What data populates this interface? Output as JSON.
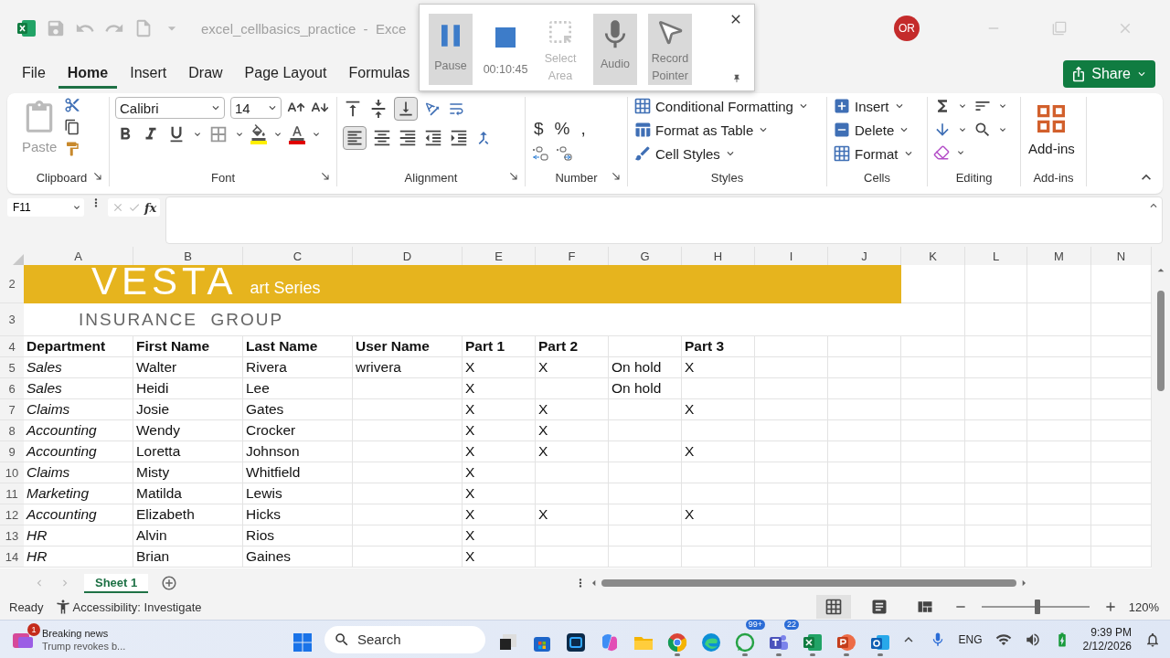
{
  "title_bar": {
    "document": "excel_cellbasics_practice  -  Exce",
    "avatar": "OR"
  },
  "ribbon_tabs": [
    {
      "label": "File",
      "selected": false
    },
    {
      "label": "Home",
      "selected": true
    },
    {
      "label": "Insert",
      "selected": false
    },
    {
      "label": "Draw",
      "selected": false
    },
    {
      "label": "Page Layout",
      "selected": false
    },
    {
      "label": "Formulas",
      "selected": false
    }
  ],
  "share": "Share",
  "ribbon": {
    "clipboard": {
      "paste": "Paste",
      "label": "Clipboard"
    },
    "font": {
      "name": "Calibri",
      "size": "14",
      "label": "Font"
    },
    "alignment": {
      "label": "Alignment"
    },
    "number": {
      "currency": "$",
      "percent": "%",
      "comma": ",",
      "label": "Number"
    },
    "styles": {
      "items": [
        "Conditional Formatting",
        "Format as Table",
        "Cell Styles"
      ],
      "label": "Styles"
    },
    "cells": {
      "items": [
        "Insert",
        "Delete",
        "Format"
      ],
      "label": "Cells"
    },
    "editing": {
      "label": "Editing"
    },
    "addins": {
      "button": "Add-ins",
      "label": "Add-ins"
    }
  },
  "recorder": {
    "items": [
      {
        "kind": "pause",
        "label": "Pause",
        "on": true,
        "disabled": false
      },
      {
        "kind": "timer",
        "label": "00:10:45",
        "on": false,
        "disabled": false
      },
      {
        "kind": "select",
        "label": "Select Area",
        "on": false,
        "disabled": true
      },
      {
        "kind": "audio",
        "label": "Audio",
        "on": true,
        "disabled": false
      },
      {
        "kind": "pointer",
        "label": "Record Pointer",
        "on": true,
        "disabled": false
      }
    ]
  },
  "formula_bar": {
    "name_box": "F11",
    "fx": "fx"
  },
  "sheet": {
    "columns": [
      "A",
      "B",
      "C",
      "D",
      "E",
      "F",
      "G",
      "H",
      "I",
      "J",
      "K",
      "L",
      "M",
      "N"
    ],
    "banner": {
      "row": "2",
      "logo": "VESTA",
      "subtitle": "art Series"
    },
    "logo_row": {
      "row": "3",
      "text": "INSURANCE  GROUP"
    },
    "rows": [
      {
        "number": "4",
        "kind": "header",
        "cells": {
          "A": "Department",
          "B": "First Name",
          "C": "Last Name",
          "D": "User Name",
          "E": "Part 1",
          "F": "Part 2",
          "H": "Part 3"
        }
      },
      {
        "number": "5",
        "kind": "data",
        "cells": {
          "A": "Sales",
          "B": "Walter",
          "C": "Rivera",
          "D": "wrivera",
          "E": "X",
          "F": "X",
          "G": "On hold",
          "H": "X"
        }
      },
      {
        "number": "6",
        "kind": "data",
        "cells": {
          "A": "Sales",
          "B": "Heidi",
          "C": "Lee",
          "E": "X",
          "G": "On hold"
        }
      },
      {
        "number": "7",
        "kind": "data",
        "cells": {
          "A": "Claims",
          "B": "Josie",
          "C": "Gates",
          "E": "X",
          "F": "X",
          "H": "X"
        }
      },
      {
        "number": "8",
        "kind": "data",
        "cells": {
          "A": "Accounting",
          "B": "Wendy",
          "C": "Crocker",
          "E": "X",
          "F": "X"
        }
      },
      {
        "number": "9",
        "kind": "data",
        "cells": {
          "A": "Accounting",
          "B": "Loretta",
          "C": "Johnson",
          "E": "X",
          "F": "X",
          "H": "X"
        }
      },
      {
        "number": "10",
        "kind": "data",
        "cells": {
          "A": "Claims",
          "B": "Misty",
          "C": "Whitfield",
          "E": "X"
        }
      },
      {
        "number": "11",
        "kind": "data",
        "cells": {
          "A": "Marketing",
          "B": "Matilda",
          "C": "Lewis",
          "E": "X"
        }
      },
      {
        "number": "12",
        "kind": "data",
        "cells": {
          "A": "Accounting",
          "B": "Elizabeth",
          "C": "Hicks",
          "E": "X",
          "F": "X",
          "H": "X"
        }
      },
      {
        "number": "13",
        "kind": "data",
        "cells": {
          "A": "HR",
          "B": "Alvin",
          "C": "Rios",
          "E": "X"
        }
      },
      {
        "number": "14",
        "kind": "data",
        "cells": {
          "A": "HR",
          "B": "Brian",
          "C": "Gaines",
          "E": "X"
        }
      }
    ]
  },
  "sheet_tabs": [
    {
      "label": "Sheet 1",
      "selected": true
    }
  ],
  "status_bar": {
    "ready": "Ready",
    "accessibility": "Accessibility: Investigate",
    "zoom": "120%",
    "level": 0.49,
    "views": [
      {
        "kind": "normal",
        "selected": true
      },
      {
        "kind": "page_layout",
        "selected": false
      },
      {
        "kind": "page_break",
        "selected": false
      }
    ]
  },
  "taskbar": {
    "news": {
      "badge": "1",
      "title": "Breaking news",
      "text": "Trump revokes b..."
    },
    "search": "Search",
    "apps": [
      {
        "kind": "start",
        "running": false
      },
      {
        "kind": "task_view",
        "running": false
      },
      {
        "kind": "store",
        "running": false
      },
      {
        "kind": "photoshop",
        "running": false
      },
      {
        "kind": "copilot",
        "running": false
      },
      {
        "kind": "explorer",
        "running": false
      },
      {
        "kind": "chrome",
        "running": true
      },
      {
        "kind": "edge",
        "running": false
      },
      {
        "kind": "whatsapp",
        "running": true,
        "badge": "99+"
      },
      {
        "kind": "teams",
        "running": true,
        "badge": "22"
      },
      {
        "kind": "excel",
        "running": true
      },
      {
        "kind": "powerpoint",
        "running": true
      },
      {
        "kind": "outlook",
        "running": true
      }
    ],
    "language": "ENG",
    "time": "9:39 PM",
    "date": "2/12/2026"
  }
}
